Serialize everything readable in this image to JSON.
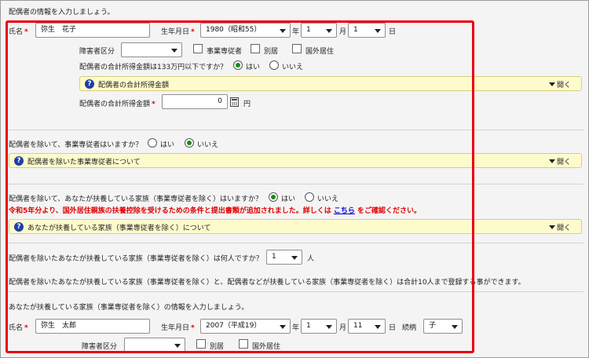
{
  "intro": "配偶者の情報を入力しましょう。",
  "spouse": {
    "name_label": "氏名",
    "required_mark": "*",
    "name_value": "弥生　花子",
    "dob_label": "生年月日",
    "era": "1980（昭和55）",
    "year_suffix": "年",
    "month": "1",
    "month_suffix": "月",
    "day": "1",
    "day_suffix": "日",
    "disability_label": "障害者区分",
    "disability_value": "",
    "business_worker_label": "事業専従者",
    "separate_label": "別居",
    "overseas_label": "国外居住",
    "income_question": "配偶者の合計所得金額は133万円以下ですか？",
    "yes_label": "はい",
    "no_label": "いいえ",
    "income_accordion_title": "配偶者の合計所得金額",
    "open_label": "開く",
    "income_amount_label": "配偶者の合計所得金額",
    "income_amount_value": "0",
    "yen_label": "円"
  },
  "business_worker": {
    "question": "配偶者を除いて、事業専従者はいますか？",
    "yes_label": "はい",
    "no_label": "いいえ",
    "accordion_title": "配偶者を除いた事業専従者について",
    "open_label": "開く"
  },
  "dependents": {
    "question": "配偶者を除いて、あなたが扶養している家族（事業専従者を除く）はいますか？",
    "yes_label": "はい",
    "no_label": "いいえ",
    "notice_text": "令和5年分より、国外居住親族の扶養控除を受けるための条件と提出書類が追加されました。詳しくは",
    "notice_link": "こちら",
    "notice_tail": "をご確認ください。",
    "accordion_title": "あなたが扶養している家族（事業専従者を除く）について",
    "open_label": "開く",
    "count_question": "配偶者を除いたあなたが扶養している家族（事業専従者を除く）は何人ですか？",
    "count_value": "1",
    "count_unit": "人",
    "limit_text": "配偶者を除いたあなたが扶養している家族（事業専従者を除く）と、配偶者などが扶養している家族（事業専従者を除く）は合計10人まで登録する事ができます。",
    "info_intro": "あなたが扶養している家族（事業専従者を除く）の情報を入力しましょう。"
  },
  "dependent1": {
    "name_label": "氏名",
    "required_mark": "*",
    "name_value": "弥生　太郎",
    "dob_label": "生年月日",
    "era": "2007（平成19）",
    "year_suffix": "年",
    "month": "1",
    "month_suffix": "月",
    "day": "11",
    "day_suffix": "日",
    "relation_label": "続柄",
    "relation_value": "子",
    "disability_label": "障害者区分",
    "disability_value": "",
    "separate_label": "別居",
    "overseas_label": "国外居住"
  }
}
